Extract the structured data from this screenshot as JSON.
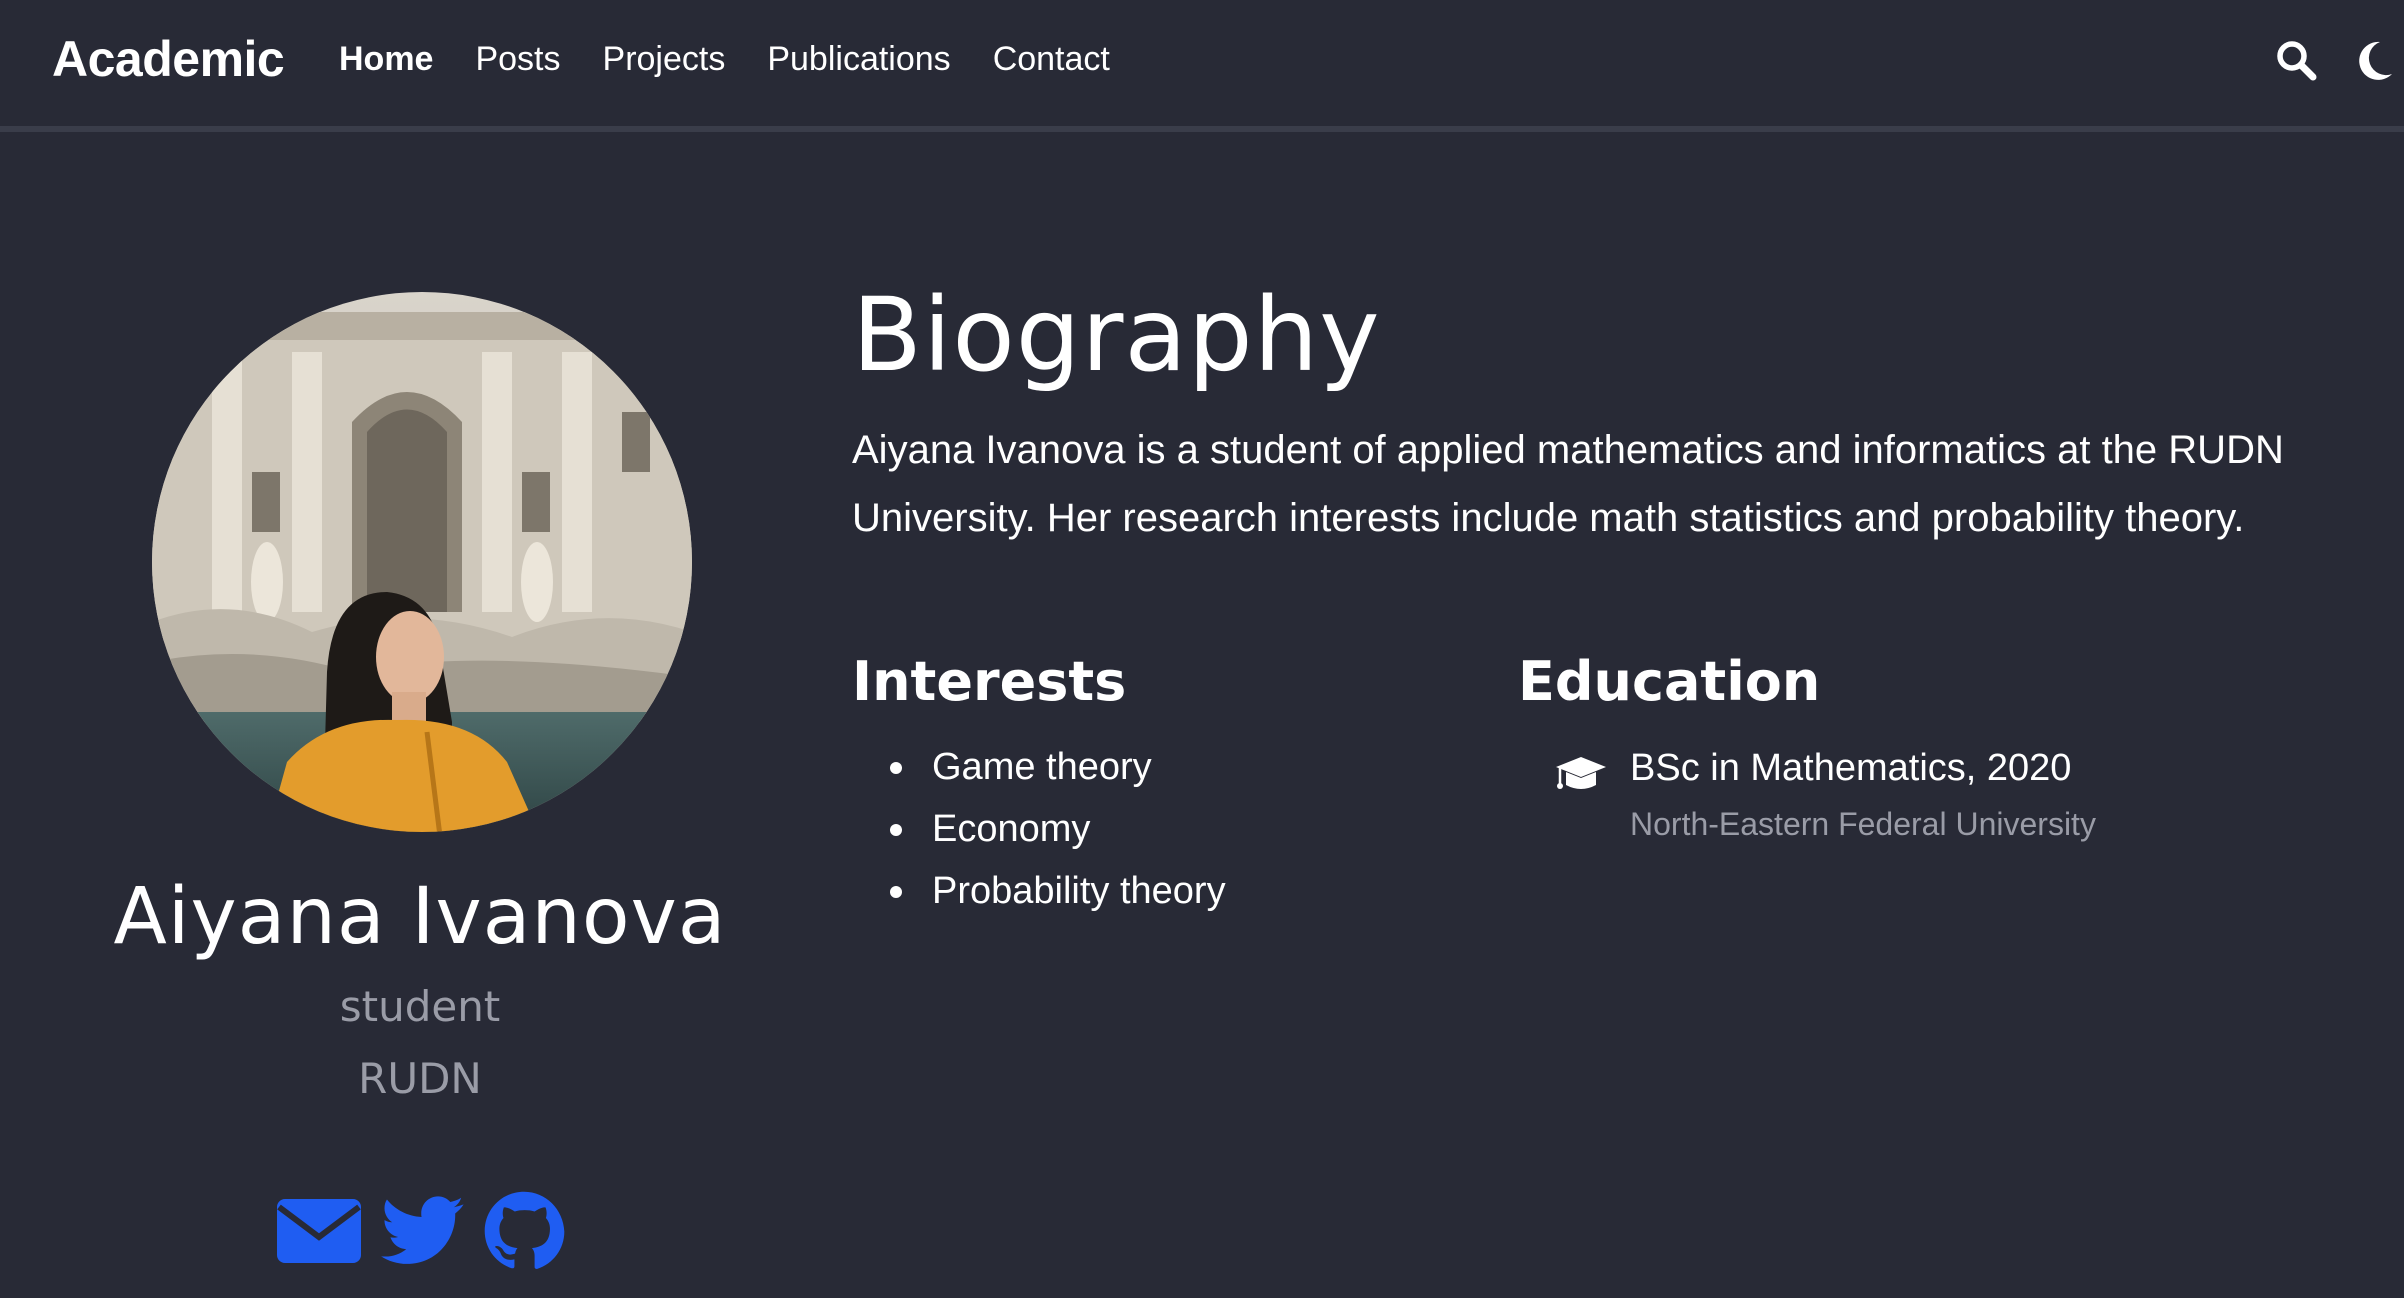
{
  "navbar": {
    "brand": "Academic",
    "links": [
      "Home",
      "Posts",
      "Projects",
      "Publications",
      "Contact"
    ],
    "active": "Home",
    "icons": [
      "search-icon",
      "moon-icon"
    ]
  },
  "profile": {
    "name": "Aiyana Ivanova",
    "role": "student",
    "organization": "RUDN",
    "social_icons": [
      "envelope-icon",
      "twitter-icon",
      "github-icon"
    ],
    "social_color": "#1f5df2"
  },
  "biography": {
    "title": "Biography",
    "text": "Aiyana Ivanova is a student of applied mathematics and informatics at the RUDN University. Her research interests include math statistics and probability theory."
  },
  "interests": {
    "title": "Interests",
    "items": [
      "Game theory",
      "Economy",
      "Probability theory"
    ]
  },
  "education": {
    "title": "Education",
    "items": [
      {
        "degree": "BSc in Mathematics, 2020",
        "institution": "North-Eastern Federal University",
        "icon": "graduation-cap-icon"
      }
    ]
  },
  "colors": {
    "background": "#282a36",
    "text": "#ffffff",
    "muted": "#9a9ca7",
    "accent": "#1f5df2"
  }
}
